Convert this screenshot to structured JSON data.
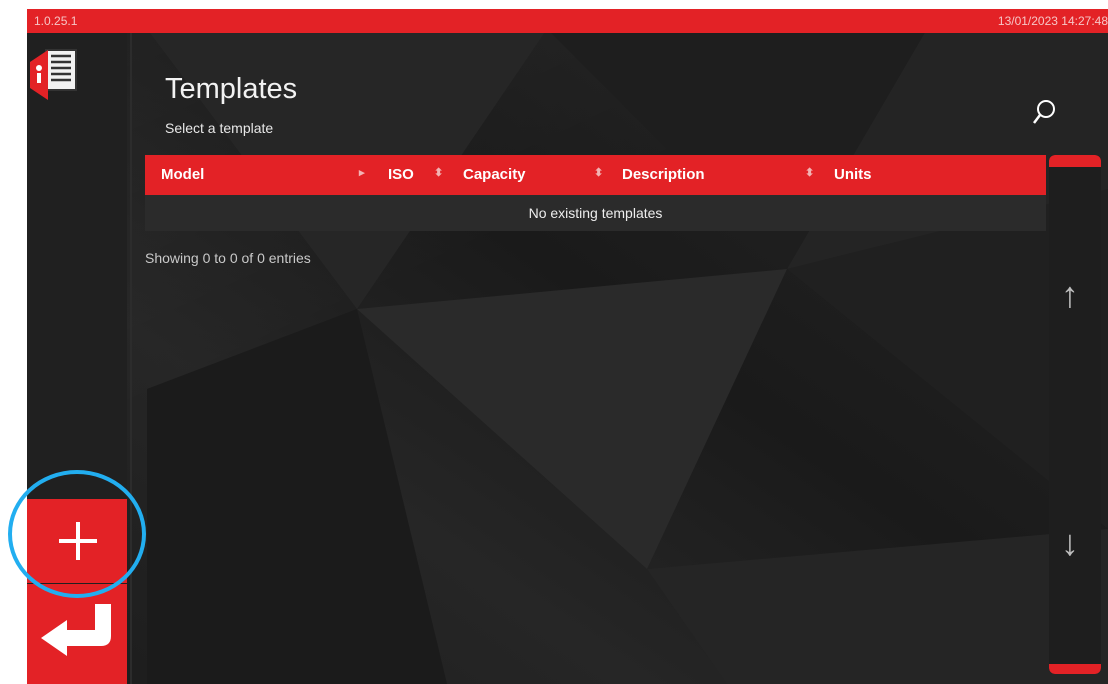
{
  "status_bar": {
    "version": "1.0.25.1",
    "datetime": "13/01/2023 14:27:48"
  },
  "header": {
    "title": "Templates",
    "subtitle": "Select a template"
  },
  "table": {
    "columns": [
      "Model",
      "ISO",
      "Capacity",
      "Description",
      "Units"
    ],
    "empty_message": "No existing templates",
    "info": "Showing 0 to 0 of 0 entries"
  },
  "scroll": {
    "up_arrow": "↑",
    "down_arrow": "↓"
  },
  "icons": {
    "logo": "templates-document-icon",
    "search": "search-icon",
    "add": "plus-icon",
    "back": "return-arrow-icon"
  },
  "colors": {
    "accent": "#e32226",
    "background": "#1f1f1f",
    "highlight": "#22aef0"
  }
}
